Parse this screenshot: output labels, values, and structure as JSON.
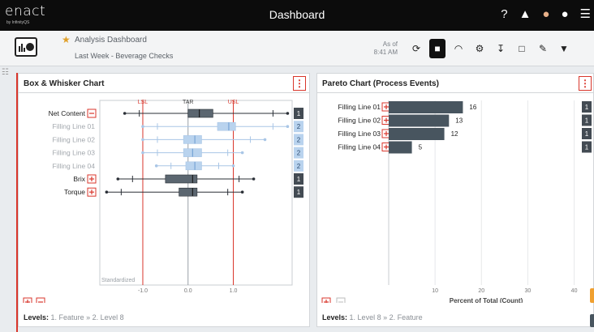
{
  "topbar": {
    "logo": "enact",
    "logo_sub": "by InfinityQS",
    "title": "Dashboard",
    "icons": [
      "help-icon",
      "bell-icon",
      "user-avatar",
      "users-icon",
      "menu-icon"
    ]
  },
  "subbar": {
    "title": "Analysis Dashboard",
    "description": "Last Week - Beverage Checks",
    "asof_label": "As of",
    "asof_time": "8:41 AM",
    "icons": [
      "refresh-icon",
      "lock-icon",
      "gauge-icon",
      "gear-icon",
      "download-icon",
      "document-icon",
      "edit-document-icon",
      "filter-icon"
    ]
  },
  "left_panel": {
    "title": "Box & Whisker Chart",
    "kebab": "⋮",
    "levels_label": "Levels:",
    "levels_value": "1. Feature » 2. Level 8",
    "standardized_label": "Standardized"
  },
  "right_panel": {
    "title": "Pareto Chart (Process Events)",
    "kebab": "⋮",
    "levels_label": "Levels:",
    "levels_value": "1. Level 8 » 2. Feature",
    "xlabel": "Percent of Total (Count)"
  },
  "chart_data": [
    {
      "type": "box",
      "title": "Box & Whisker Chart",
      "spec_labels": [
        "LSL",
        "TAR",
        "USL"
      ],
      "spec_values": [
        -1.0,
        0.0,
        1.0
      ],
      "x_ticks": [
        "-1.0",
        "0.0",
        "1.0"
      ],
      "xlim": [
        -1.95,
        2.3
      ],
      "series": [
        {
          "name": "Net Content",
          "count": "1",
          "min": -1.4,
          "q1": 0.0,
          "median": 0.25,
          "q3": 0.55,
          "max": 2.2,
          "faded": false,
          "toggle": "minus"
        },
        {
          "name": "Filling Line 01",
          "count": "2",
          "min": -1.0,
          "q1": 0.65,
          "median": 0.9,
          "q3": 1.05,
          "max": 2.2,
          "faded": true,
          "toggle": "none"
        },
        {
          "name": "Filling Line 02",
          "count": "2",
          "min": -1.0,
          "q1": -0.1,
          "median": 0.15,
          "q3": 0.3,
          "max": 1.7,
          "faded": true,
          "toggle": "none"
        },
        {
          "name": "Filling Line 03",
          "count": "2",
          "min": -1.0,
          "q1": -0.1,
          "median": 0.1,
          "q3": 0.3,
          "max": 1.2,
          "faded": true,
          "toggle": "none"
        },
        {
          "name": "Filling Line 04",
          "count": "2",
          "min": -0.7,
          "q1": -0.05,
          "median": 0.15,
          "q3": 0.3,
          "max": 1.0,
          "faded": true,
          "toggle": "none"
        },
        {
          "name": "Brix",
          "count": "1",
          "min": -1.55,
          "q1": -0.5,
          "median": 0.1,
          "q3": 0.2,
          "max": 1.45,
          "faded": false,
          "toggle": "plus"
        },
        {
          "name": "Torque",
          "count": "1",
          "min": -1.8,
          "q1": -0.2,
          "median": 0.1,
          "q3": 0.2,
          "max": 1.2,
          "faded": false,
          "toggle": "plus"
        }
      ]
    },
    {
      "type": "bar",
      "title": "Pareto Chart (Process Events)",
      "categories": [
        "Filling Line 01",
        "Filling Line 02",
        "Filling Line 03",
        "Filling Line 04"
      ],
      "values": [
        16,
        13,
        12,
        5
      ],
      "counts": [
        "1",
        "1",
        "1",
        "1"
      ],
      "x_ticks": [
        "10",
        "20",
        "30",
        "40"
      ],
      "xlim": [
        0,
        42
      ],
      "xlabel": "Percent of Total (Count)"
    }
  ]
}
